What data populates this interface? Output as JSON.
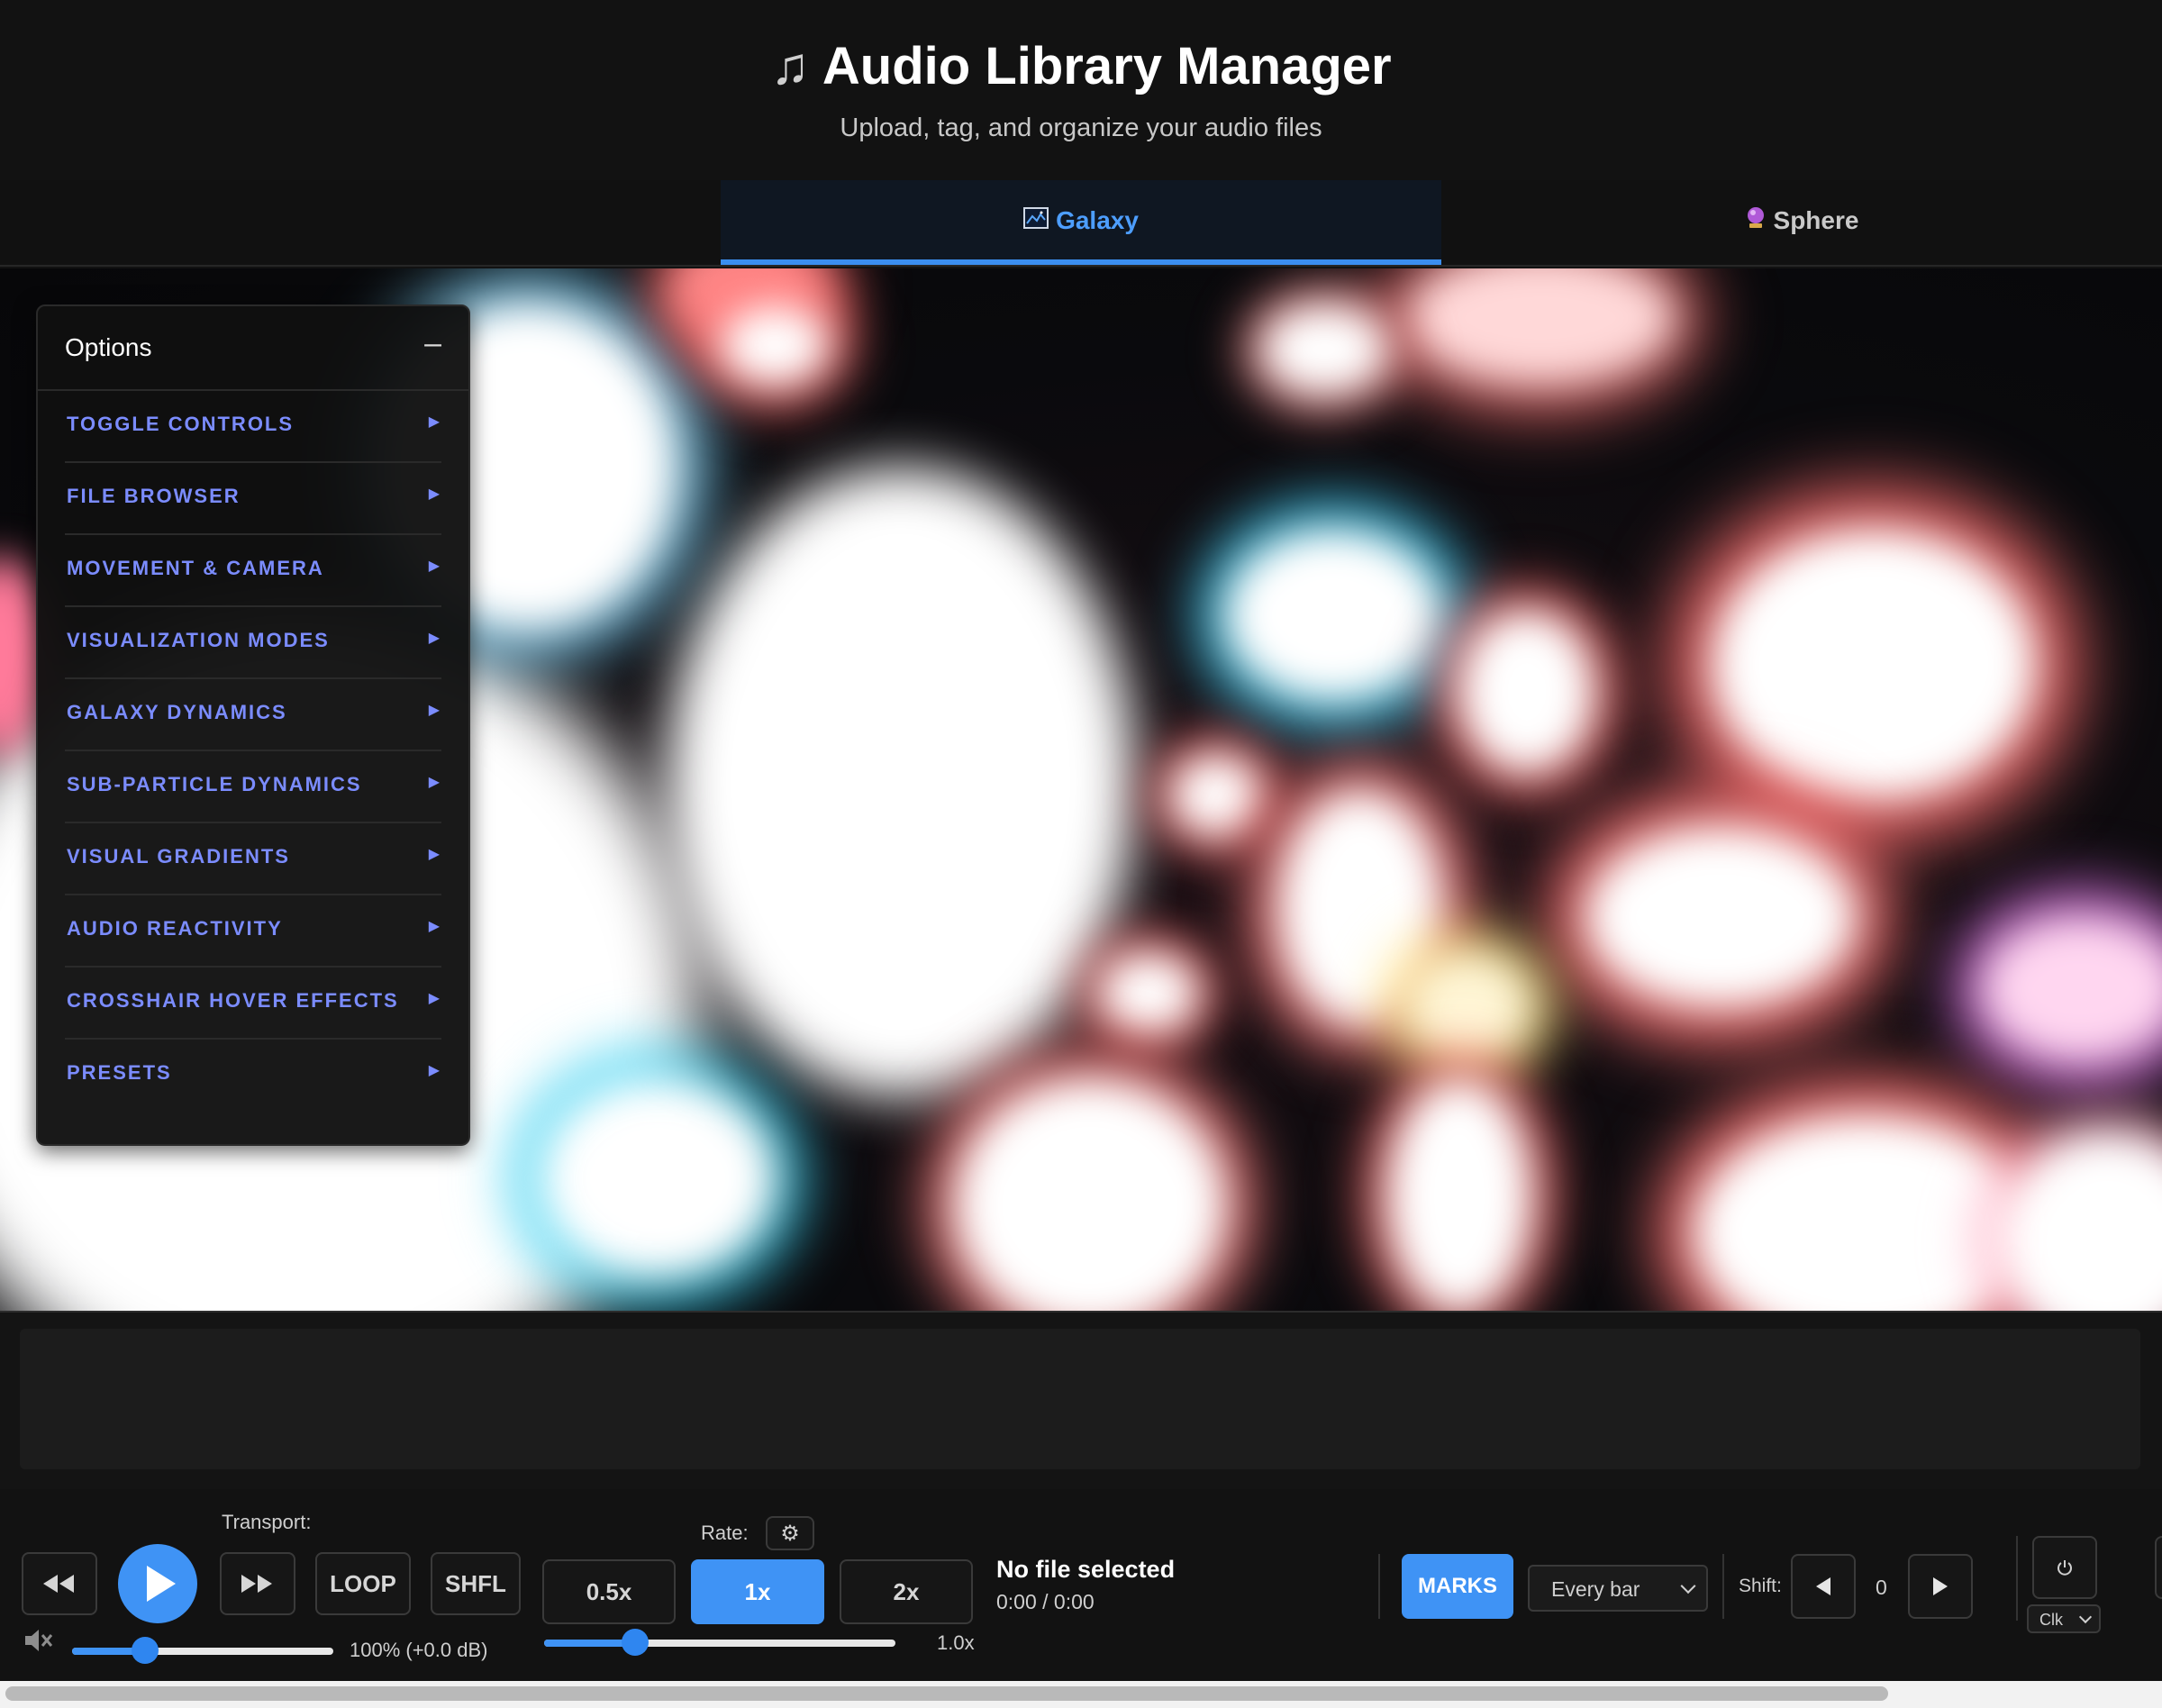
{
  "header": {
    "title": "Audio Library Manager",
    "title_icon": "music-note-icon",
    "subtitle": "Upload, tag, and organize your audio files"
  },
  "tabs": [
    {
      "label": "Galaxy",
      "icon": "galaxy-icon",
      "active": true
    },
    {
      "label": "Sphere",
      "icon": "crystal-ball-icon",
      "active": false
    }
  ],
  "options": {
    "title": "Options",
    "collapse_symbol": "–",
    "items": [
      {
        "label": "TOGGLE CONTROLS"
      },
      {
        "label": "FILE BROWSER"
      },
      {
        "label": "MOVEMENT & CAMERA"
      },
      {
        "label": "VISUALIZATION MODES"
      },
      {
        "label": "GALAXY DYNAMICS"
      },
      {
        "label": "SUB-PARTICLE DYNAMICS"
      },
      {
        "label": "VISUAL GRADIENTS"
      },
      {
        "label": "AUDIO REACTIVITY"
      },
      {
        "label": "CROSSHAIR HOVER EFFECTS"
      },
      {
        "label": "PRESETS"
      }
    ]
  },
  "transport": {
    "label": "Transport:",
    "rewind_icon": "rewind-icon",
    "play_icon": "play-icon",
    "forward_icon": "fast-forward-icon",
    "loop_label": "LOOP",
    "shuffle_label": "SHFL",
    "volume_icon": "speaker-muted-icon",
    "volume_value": 0.28,
    "volume_text": "100% (+0.0 dB)"
  },
  "rate": {
    "label": "Rate:",
    "settings_icon": "gear-icon",
    "options": [
      "0.5x",
      "1x",
      "2x"
    ],
    "selected": "1x",
    "slider_value": 0.26,
    "value_text": "1.0x"
  },
  "file": {
    "name": "No file selected",
    "time": "0:00 / 0:00"
  },
  "marks": {
    "button_label": "MARKS",
    "interval_selected": "Every bar",
    "shift_label": "Shift:",
    "shift_value": "0",
    "clock_select": "Clk",
    "power_icon": "power-icon"
  },
  "colors": {
    "accent": "#3f93f5",
    "tab_active": "#4d9eff",
    "option_label": "#7b8cff",
    "background": "#121212"
  }
}
